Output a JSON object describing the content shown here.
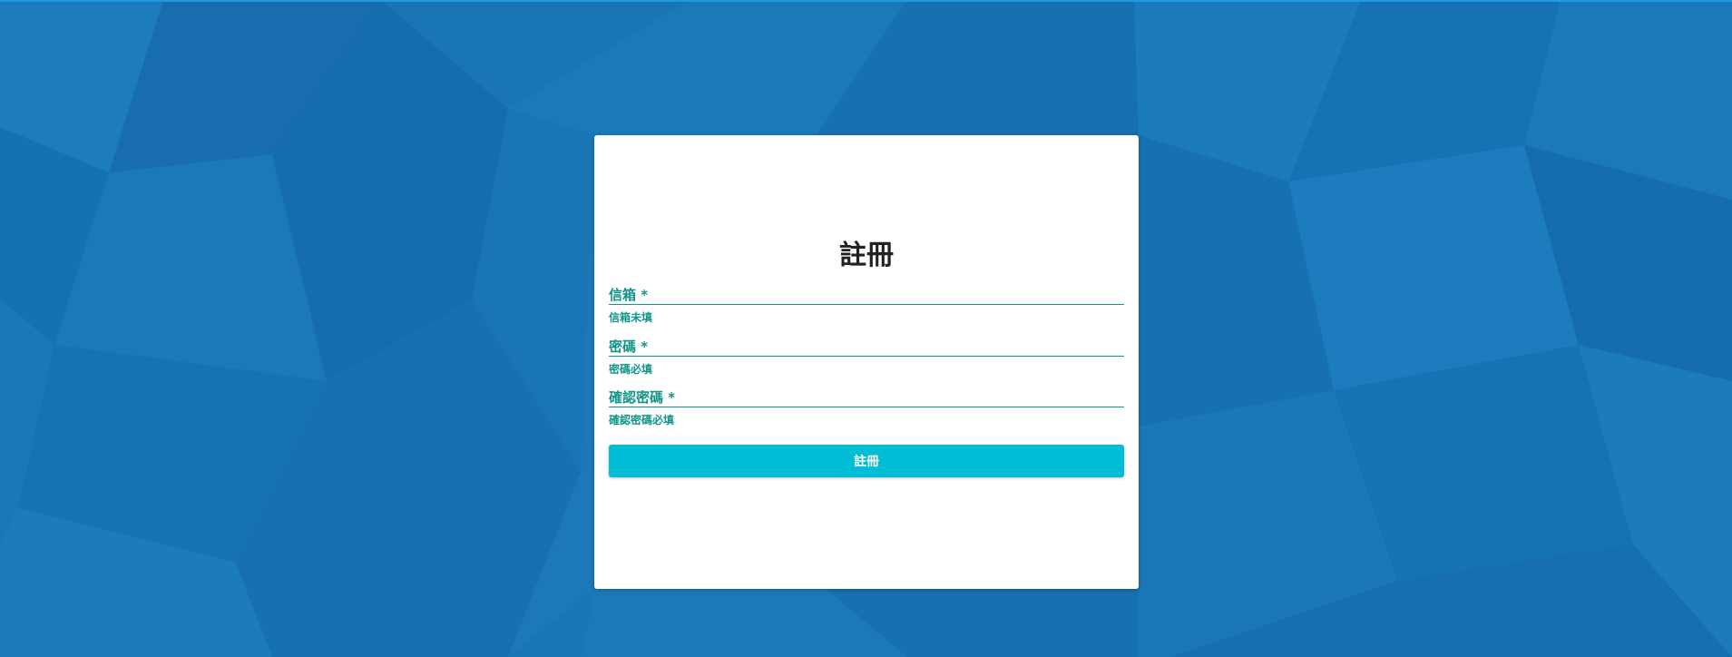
{
  "colors": {
    "background": "#1a75b5",
    "accent": "#13958a",
    "button": "#00bcd4"
  },
  "register": {
    "title": "註冊",
    "fields": [
      {
        "label": "信箱 *",
        "value": "",
        "error": "信箱未填"
      },
      {
        "label": "密碼 *",
        "value": "",
        "error": "密碼必填"
      },
      {
        "label": "確認密碼 *",
        "value": "",
        "error": "確認密碼必填"
      }
    ],
    "submit_label": "註冊"
  }
}
